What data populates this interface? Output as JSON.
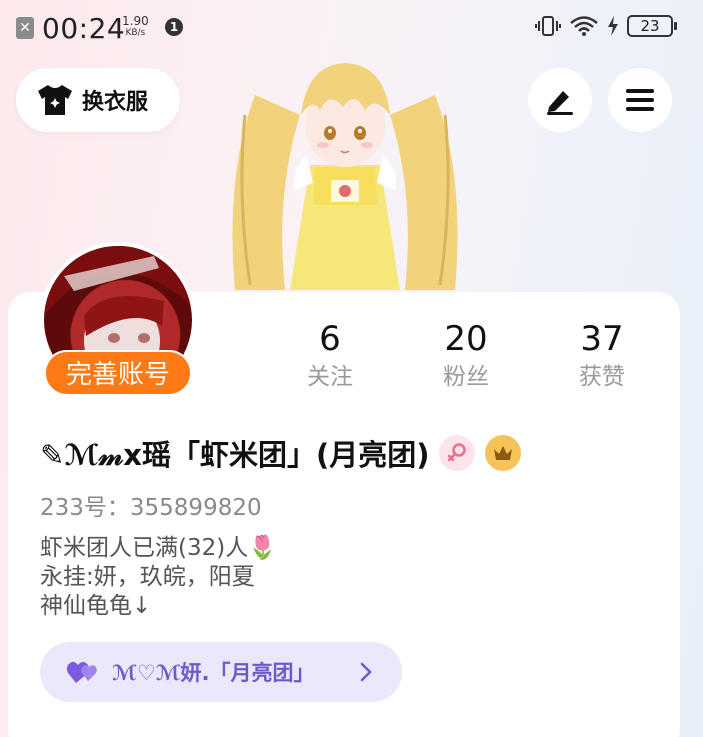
{
  "status_bar": {
    "time": "00:24",
    "speed_value": "1.90",
    "speed_unit": "KB/s",
    "notification_count": "1",
    "battery": "23"
  },
  "top_bar": {
    "change_clothes_label": "换衣服"
  },
  "profile": {
    "complete_account_label": "完善账号",
    "name": "✎ℳ𝓂x瑶「虾米团」(月亮团)",
    "uid": "233号：355899820",
    "bio_lines": [
      "虾米团人已满(32)人🌷",
      "永挂:妍，玖皖，阳夏",
      "神仙龟龟↓"
    ],
    "group_pill_label": "ℳ♡ℳ妍.「月亮团」"
  },
  "stats": [
    {
      "value": "6",
      "label": "关注"
    },
    {
      "value": "20",
      "label": "粉丝"
    },
    {
      "value": "37",
      "label": "获赞"
    }
  ],
  "colors": {
    "accent_orange": "#ff7a14",
    "group_pill_bg": "#ece8fb",
    "group_pill_text": "#6a5acd",
    "female_badge": "#f06a8a",
    "crown_badge": "#f6c35a"
  }
}
